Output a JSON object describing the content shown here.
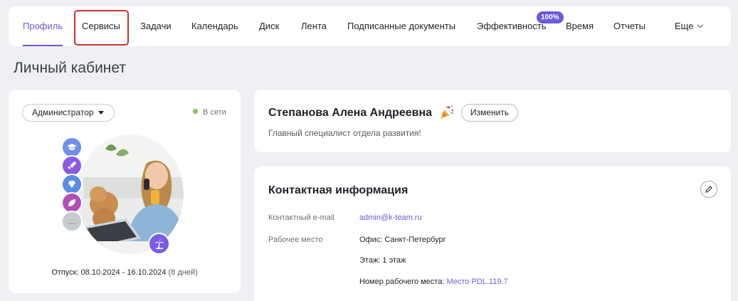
{
  "nav": {
    "tabs": [
      {
        "label": "Профиль"
      },
      {
        "label": "Сервисы"
      },
      {
        "label": "Задачи"
      },
      {
        "label": "Календарь"
      },
      {
        "label": "Диск"
      },
      {
        "label": "Лента"
      },
      {
        "label": "Подписанные документы"
      },
      {
        "label": "Эффективность"
      },
      {
        "label": "Время"
      },
      {
        "label": "Отчеты"
      }
    ],
    "efficiency_badge": "100%",
    "more_label": "Еще",
    "active_tab": "Профиль",
    "highlighted_tab": "Сервисы"
  },
  "page": {
    "title": "Личный кабинет"
  },
  "profile": {
    "role": "Администратор",
    "status": "В сети",
    "vacation_label": "Отпуск:",
    "vacation_dates": "08.10.2024 - 16.10.2024",
    "vacation_days": "(8 дней)",
    "more_achievements": "...",
    "name": "Степанова Алена Андреевна",
    "edit_label": "Изменить",
    "position": "Главный специалист отдела развития!"
  },
  "contact": {
    "title": "Контактная информация",
    "email_label": "Контактный e-mail",
    "email": "admin@k-team.ru",
    "workplace_label": "Рабочее место",
    "office": "Офис: Санкт-Петербург",
    "floor": "Этаж: 1 этаж",
    "desk_label": "Номер рабочего места:",
    "desk_value": "Место PDL.119.7"
  },
  "colors": {
    "accent": "#6b5bd6",
    "online": "#8bc34a",
    "highlight": "#c9302c",
    "achievement_1": "#6f8fe8",
    "achievement_2": "#8a5be0",
    "achievement_3": "#5b8de6",
    "achievement_4": "#b24fb8",
    "achievement_more": "#c7cacf"
  }
}
